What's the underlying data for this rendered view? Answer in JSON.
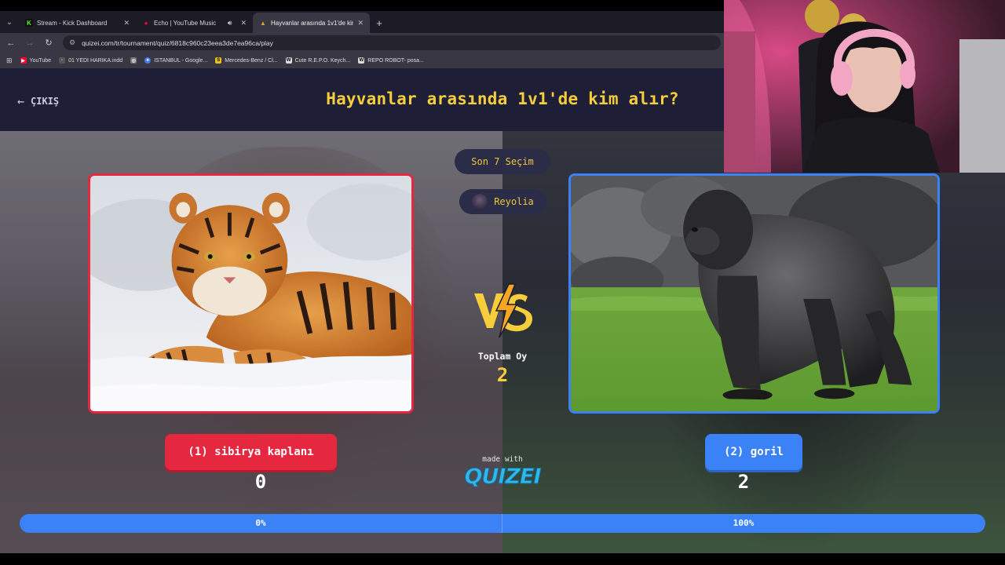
{
  "browser": {
    "tabs": [
      {
        "title": "Stream - Kick Dashboard",
        "favicon": "K",
        "favicon_color": "#53fc18"
      },
      {
        "title": "Echo | YouTube Music",
        "favicon": "●",
        "favicon_color": "#ff0033",
        "sound_icon": "speaker-icon"
      },
      {
        "title": "Hayvanlar arasında 1v1'de kim",
        "favicon": "▲",
        "favicon_color": "#e0a030",
        "active": true
      }
    ],
    "url": "quizei.com/tr/tournament/quiz/6818c960c23eea3de7ea96ca/play",
    "bookmarks": [
      {
        "label": "YouTube",
        "icon_color": "#ff0033",
        "icon": "▶"
      },
      {
        "label": "01 YEDI HARIKA.indd",
        "icon_color": "#555",
        "icon": "◦"
      },
      {
        "label": "",
        "icon_color": "#777",
        "icon": "◎"
      },
      {
        "label": "ISTANBUL - Google...",
        "icon_color": "#4a7ee6",
        "icon": "●"
      },
      {
        "label": "Mercedes-Benz / Cl...",
        "icon_color": "#e7c218",
        "icon": "S"
      },
      {
        "label": "Cute R.E.P.O. Keych...",
        "icon_color": "#ddd",
        "icon": "W"
      },
      {
        "label": "REPO ROBOT- posa...",
        "icon_color": "#ddd",
        "icon": "W"
      }
    ]
  },
  "header": {
    "exit_label": "ÇIKIŞ",
    "title": "Hayvanlar arasında 1v1'de kim alır?"
  },
  "center": {
    "recent_label": "Son 7 Seçim",
    "user_name": "Reyolia",
    "total_label": "Toplam Oy",
    "total_votes": "2",
    "made_with": "made with",
    "brand": "QUIZEI"
  },
  "options": {
    "left": {
      "label": "(1) sibirya kaplanı",
      "votes": "0",
      "percent": "0%",
      "color": "#e5283f"
    },
    "right": {
      "label": "(2) goril",
      "votes": "2",
      "percent": "100%",
      "color": "#3b82f6"
    }
  },
  "progress": {
    "left_fraction": 0.0,
    "right_fraction": 1.0
  }
}
